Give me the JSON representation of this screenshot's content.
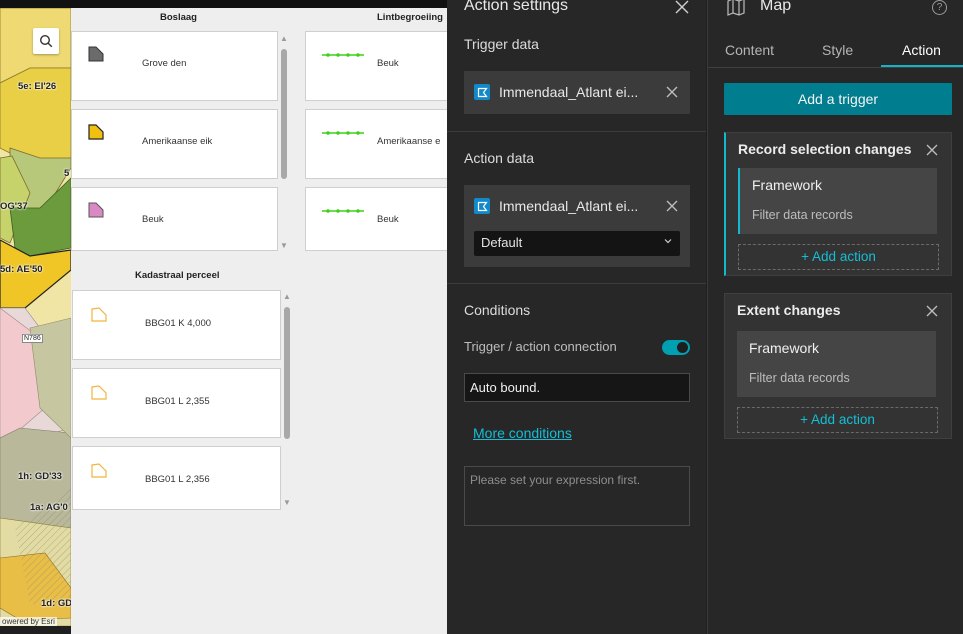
{
  "map": {
    "labels": [
      "5e: EI'26",
      "OG'37",
      "5d: AE'50",
      "1h: GD'33",
      "1a: AG'0",
      "1d: GD",
      "N786",
      "5"
    ],
    "attribution": "owered by Esri"
  },
  "legend": {
    "boslaag_title": "Boslaag",
    "lint_title": "Lintbegroeiing",
    "kadastraal_title": "Kadastraal perceel",
    "boslaag_items": [
      "Grove den",
      "Amerikaanse eik",
      "Beuk"
    ],
    "lint_items": [
      "Beuk",
      "Amerikaanse e",
      "Beuk"
    ],
    "kadastraal_items": [
      "BBG01 K 4,000",
      "BBG01 L 2,355",
      "BBG01 L 2,356"
    ],
    "colors": {
      "grove_den": "#6b6b6b",
      "amerikaanse_eik": "#f2c10f",
      "beuk": "#d98ac4",
      "lint": "#3fd11a",
      "kadastraal": "#f0b43c"
    }
  },
  "action_settings": {
    "title": "Action settings",
    "trigger_data": {
      "title": "Trigger data",
      "source": "Immendaal_Atlant ei..."
    },
    "action_data": {
      "title": "Action data",
      "source": "Immendaal_Atlant ei...",
      "view_selected": "Default"
    },
    "conditions": {
      "title": "Conditions",
      "connection_label": "Trigger / action connection",
      "connection_on": true,
      "connection_value": "Auto bound.",
      "more_link": "More conditions",
      "expression_placeholder": "Please set your expression first."
    }
  },
  "widget": {
    "title": "Map",
    "help": "?",
    "tabs": [
      "Content",
      "Style",
      "Action"
    ],
    "active_tab": "Action",
    "add_trigger": "Add a trigger",
    "triggers": [
      {
        "title": "Record selection changes",
        "action_name": "Framework",
        "action_desc": "Filter data records",
        "add_action": "+ Add action"
      },
      {
        "title": "Extent changes",
        "action_name": "Framework",
        "action_desc": "Filter data records",
        "add_action": "+ Add action"
      }
    ]
  },
  "accent_color": "#14b3c8"
}
